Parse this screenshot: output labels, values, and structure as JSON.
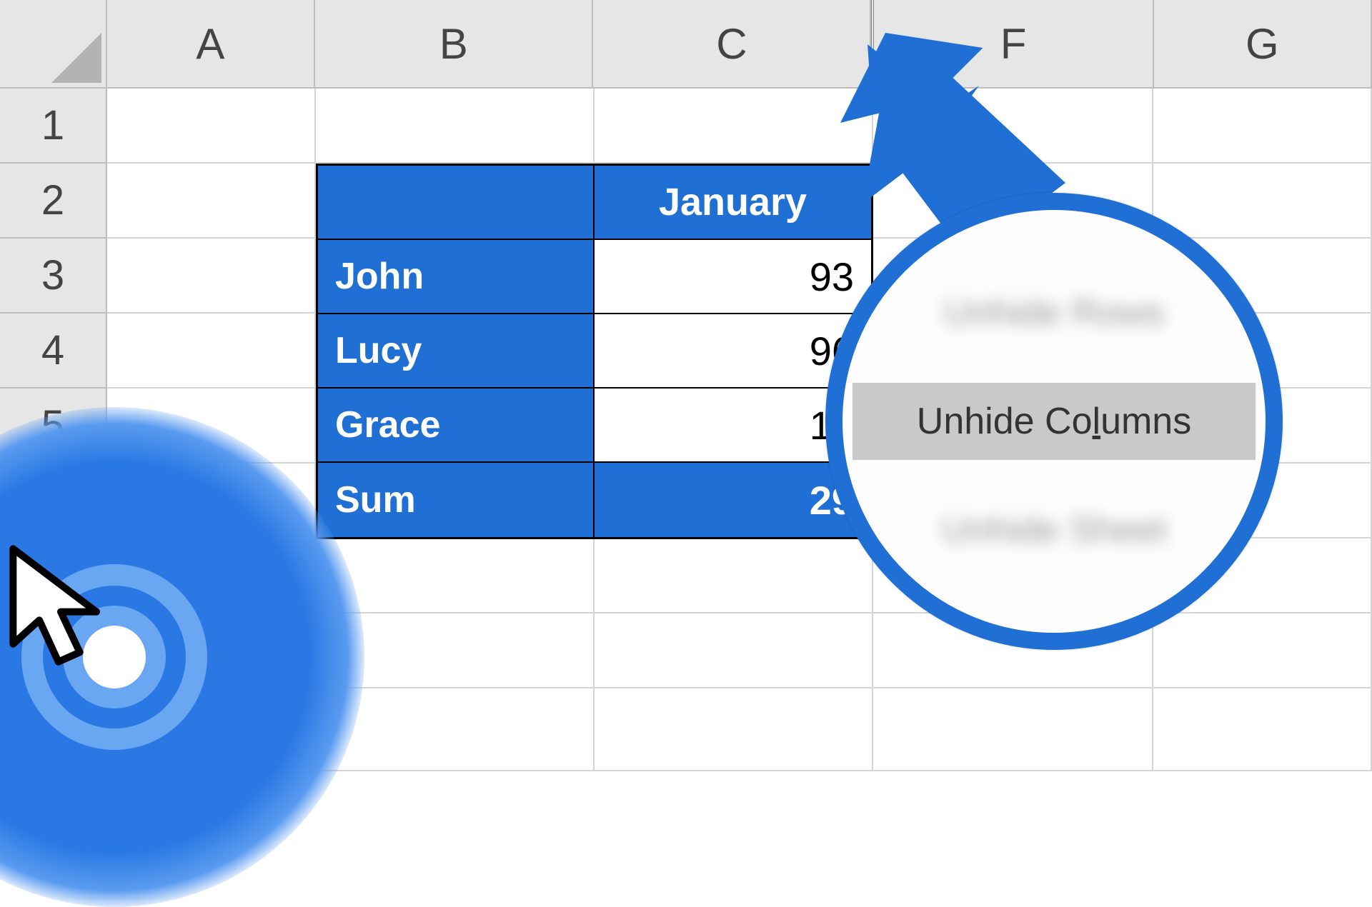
{
  "columns": {
    "A": "A",
    "B": "B",
    "C": "C",
    "F": "F",
    "G": "G"
  },
  "rows": {
    "r1": "1",
    "r2": "2",
    "r3": "3",
    "r4": "4",
    "r5": "5"
  },
  "table": {
    "header_month": "January",
    "rows": [
      {
        "name": "John",
        "value": "93"
      },
      {
        "name": "Lucy",
        "value": "96"
      },
      {
        "name": "Grace",
        "value": "10"
      }
    ],
    "sum_label": "Sum",
    "sum_value": "29"
  },
  "menu": {
    "item_rows": "Unhide Rows",
    "item_cols_prefix": "Unhide Co",
    "item_cols_underline": "l",
    "item_cols_suffix": "umns",
    "item_sheet": "Unhide Sheet"
  }
}
